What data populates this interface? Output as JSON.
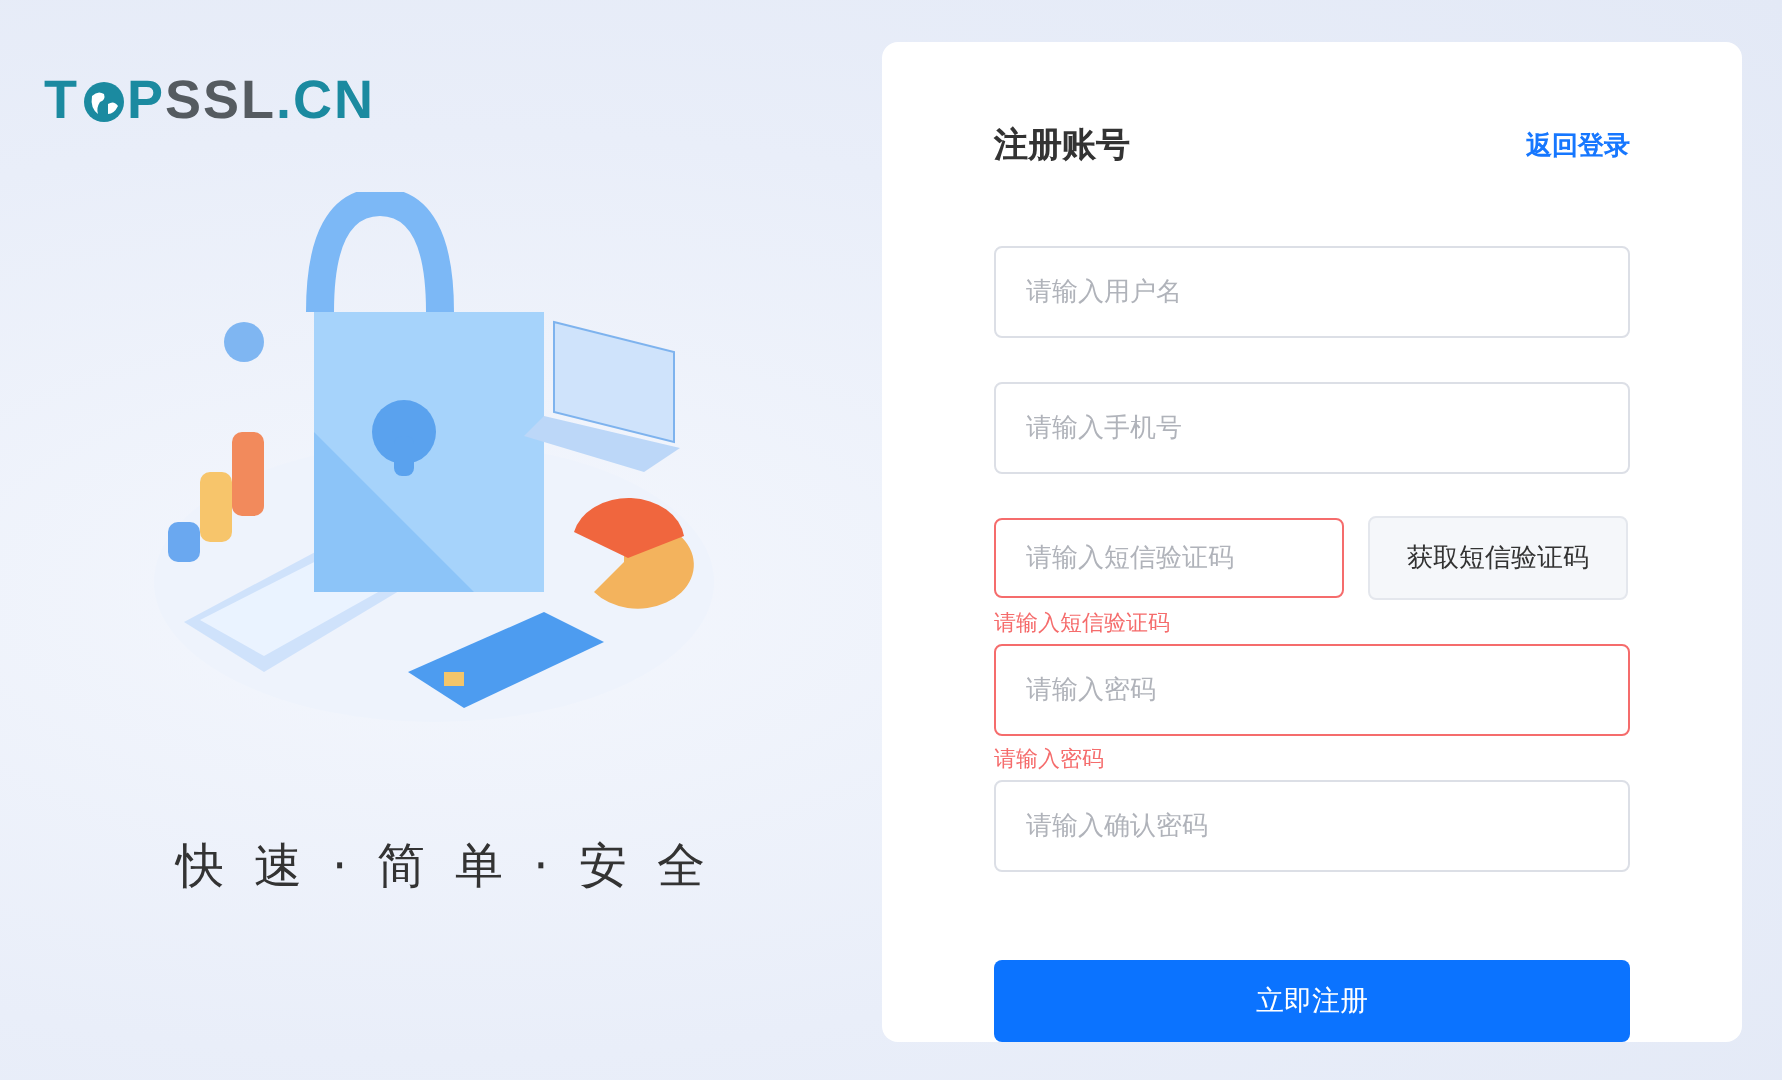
{
  "logo": {
    "parts": [
      {
        "kind": "accent",
        "text": "T"
      },
      {
        "kind": "globe"
      },
      {
        "kind": "accent",
        "text": "P"
      },
      {
        "kind": "plain",
        "text": "SSL"
      },
      {
        "kind": "accent",
        "text": ".CN"
      }
    ]
  },
  "slogan": "快速·简单·安全",
  "form": {
    "title": "注册账号",
    "back_link": "返回登录",
    "fields": [
      {
        "kind": "text",
        "placeholder": "请输入用户名"
      },
      {
        "kind": "text",
        "placeholder": "请输入手机号"
      },
      {
        "kind": "code",
        "placeholder": "请输入短信验证码",
        "button": "获取短信验证码",
        "error": "请输入短信验证码"
      },
      {
        "kind": "password",
        "placeholder": "请输入密码",
        "error": "请输入密码"
      },
      {
        "kind": "password",
        "placeholder": "请输入确认密码"
      }
    ],
    "submit": "立即注册"
  }
}
